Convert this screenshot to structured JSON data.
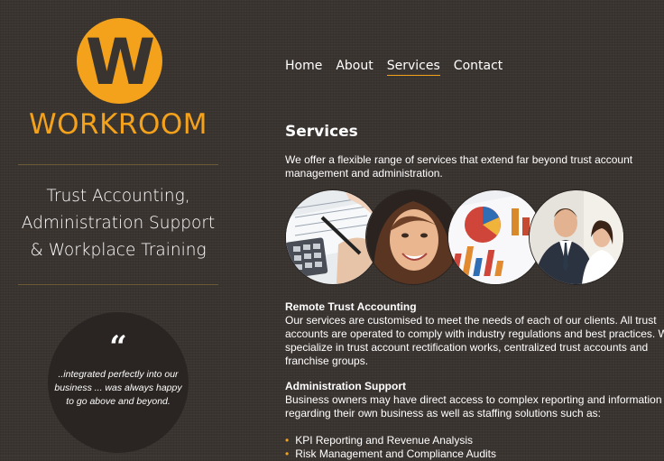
{
  "logo": {
    "mark": "W",
    "brand": "WORKROOM",
    "accent": "#f4a21b"
  },
  "tagline": [
    "Trust Accounting,",
    "Administration Support",
    "& Workplace Training"
  ],
  "quote": {
    "mark": "“",
    "lines": [
      "..integrated perfectly into our",
      "business ... was always happy",
      "to go above and beyond."
    ]
  },
  "nav": [
    {
      "label": "Home"
    },
    {
      "label": "About"
    },
    {
      "label": "Services",
      "active": true
    },
    {
      "label": "Contact"
    }
  ],
  "content": {
    "title": "Services",
    "intro": [
      "We offer a flexible range of services that extend far beyond trust account",
      "management and administration."
    ],
    "images": [
      {
        "icon": "calculator-photo"
      },
      {
        "icon": "smiling-woman-photo"
      },
      {
        "icon": "financial-charts-photo"
      },
      {
        "icon": "business-people-photo"
      }
    ],
    "sections": [
      {
        "heading": "Remote Trust Accounting",
        "lines": [
          "Our services are customised to meet the needs of each of our clients.  All trust",
          "accounts are operated to comply with industry regulations and best practices.  We",
          "specialize in trust account rectification works, centralized trust accounts and",
          "franchise groups."
        ]
      },
      {
        "heading": "Administration Support",
        "lines": [
          "Business owners may have direct access to complex reporting and information",
          "regarding their own business as well as staffing solutions such as:"
        ]
      }
    ],
    "bullets": [
      "KPI Reporting and Revenue Analysis",
      "Risk Management and Compliance Audits"
    ]
  }
}
